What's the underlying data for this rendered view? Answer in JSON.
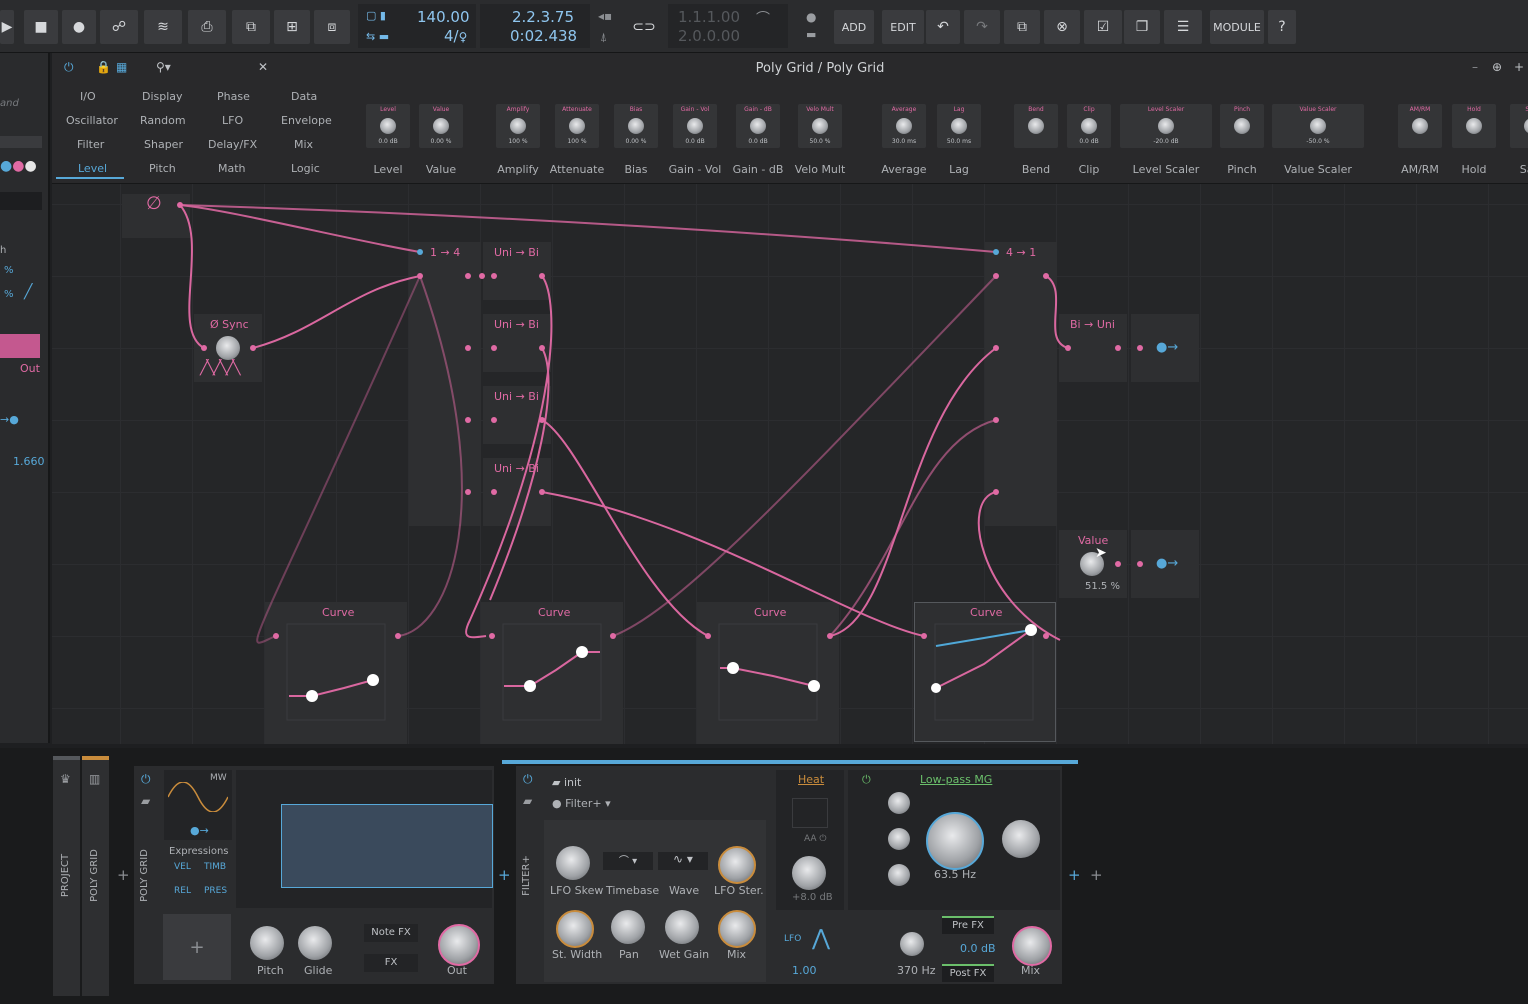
{
  "transport": {
    "tempo": "140.00",
    "time_signature": "4/",
    "position_bars": "2.2.3.75",
    "position_time": "0:02.438",
    "loop_start": "1.1.1.00",
    "loop_end": "2.0.0.00"
  },
  "toolbar": {
    "add_label": "ADD",
    "edit_label": "EDIT",
    "module_label": "MODULE"
  },
  "window": {
    "title": "Poly Grid / Poly Grid"
  },
  "categories": [
    [
      "I/O",
      "Display",
      "Phase",
      "Data"
    ],
    [
      "Oscillator",
      "Random",
      "LFO",
      "Envelope"
    ],
    [
      "Filter",
      "Shaper",
      "Delay/FX",
      "Mix"
    ],
    [
      "Level",
      "Pitch",
      "Math",
      "Logic"
    ]
  ],
  "palette": [
    {
      "name": "Level",
      "value": "0.0 dB"
    },
    {
      "name": "Value",
      "value": "0.00 %"
    },
    {
      "name": "Amplify",
      "value": "100 %"
    },
    {
      "name": "Attenuate",
      "value": "100 %"
    },
    {
      "name": "Bias",
      "value": "0.00 %"
    },
    {
      "name": "Gain - Vol",
      "value": "0.0 dB"
    },
    {
      "name": "Gain - dB",
      "value": "0.0 dB"
    },
    {
      "name": "Velo Mult",
      "value": "50.0 %"
    },
    {
      "name": "Average",
      "value": "30.0 ms"
    },
    {
      "name": "Lag",
      "value": "50.0 ms"
    },
    {
      "name": "Bend",
      "value": ""
    },
    {
      "name": "Clip",
      "value": "0.0 dB"
    },
    {
      "name": "Level Scaler",
      "value": "-20.0 dB"
    },
    {
      "name": "Pinch",
      "value": ""
    },
    {
      "name": "Value Scaler",
      "value": "-50.0 %"
    },
    {
      "name": "AM/RM",
      "value": ""
    },
    {
      "name": "Hold",
      "value": ""
    },
    {
      "name": "Sam",
      "value": ""
    }
  ],
  "left_panel": {
    "partial_top": "and",
    "partial_h": "h",
    "partial_pct": "%",
    "out_label": "Out",
    "readout": "1.660"
  },
  "modules": {
    "sync": "Ø Sync",
    "split": "1 → 4",
    "merge": "4 → 1",
    "unibi": "Uni → Bi",
    "biuni": "Bi → Uni",
    "curve": "Curve",
    "value_title": "Value",
    "value_readout": "51.5 %"
  },
  "device_bar": {
    "project_label": "PROJECT",
    "polygrid_label": "POLY GRID",
    "polygrid_device": "POLY GRID",
    "mw": "MW",
    "expressions": "Expressions",
    "vel": "VEL",
    "timb": "TIMB",
    "rel": "REL",
    "pres": "PRES",
    "pitch": "Pitch",
    "glide": "Glide",
    "note_fx": "Note FX",
    "fx": "FX",
    "out": "Out",
    "filterplus": "FILTER+",
    "preset": "init",
    "preset_type": "Filter+",
    "lfo_skew": "LFO Skew",
    "timebase": "Timebase",
    "wave": "Wave",
    "lfo_ster": "LFO Ster.",
    "st_width": "St. Width",
    "pan": "Pan",
    "wet_gain": "Wet Gain",
    "mix": "Mix",
    "heat": "Heat",
    "heat_gain": "+8.0 dB",
    "filter_name": "Low-pass MG",
    "cutoff": "63.5 Hz",
    "lfo": "LFO",
    "lfo_rate": "1.00",
    "freq2": "370 Hz",
    "pre_fx": "Pre FX",
    "post_fx": "Post FX",
    "gain_db": "0.0 dB",
    "mix2": "Mix"
  }
}
